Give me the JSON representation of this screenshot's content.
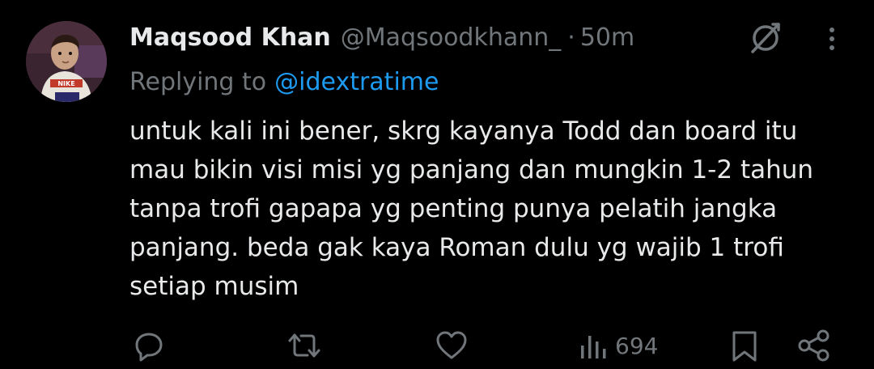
{
  "tweet": {
    "display_name": "Maqsood Khan",
    "handle": "@Maqsoodkhann_",
    "separator": "·",
    "time": "50m",
    "replying_label": "Replying to",
    "replying_to": "@idextratime",
    "text_lines": [
      "untuk kali ini bener, skrg kayanya Todd dan board itu",
      "mau bikin visi misi yg panjang dan mungkin 1-2 tahun",
      "tanpa trofi gapapa yg penting punya pelatih jangka",
      "panjang. beda gak kaya Roman dulu yg wajib 1 trofi",
      "setiap musim"
    ],
    "views": "694"
  },
  "icons": {
    "avatar": "avatar",
    "grok": "grok-icon",
    "more": "more-icon",
    "reply": "reply-icon",
    "retweet": "retweet-icon",
    "like": "heart-icon",
    "views": "views-icon",
    "bookmark": "bookmark-icon",
    "share": "share-icon"
  },
  "colors": {
    "background": "#000000",
    "primary_text": "#e7e9ea",
    "secondary_text": "#71767b",
    "link": "#1d9bf0"
  }
}
